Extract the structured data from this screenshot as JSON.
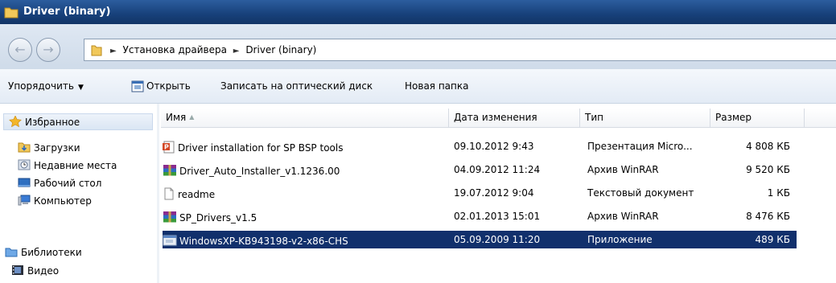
{
  "window": {
    "title": "Driver (binary)"
  },
  "address": {
    "crumbs": [
      "Установка драйвера",
      "Driver (binary)"
    ]
  },
  "toolbar": {
    "organize": "Упорядочить",
    "open": "Открыть",
    "burn": "Записать на оптический диск",
    "new_folder": "Новая папка"
  },
  "nav": {
    "favorites": "Избранное",
    "downloads": "Загрузки",
    "recent": "Недавние места",
    "desktop": "Рабочий стол",
    "computer": "Компьютер",
    "libraries": "Библиотеки",
    "video": "Видео"
  },
  "columns": {
    "name": "Имя",
    "date": "Дата изменения",
    "type": "Тип",
    "size": "Размер"
  },
  "files": [
    {
      "name": "Driver installation for SP BSP tools",
      "date": "09.10.2012 9:43",
      "type": "Презентация Micro...",
      "size": "4 808 КБ",
      "icon": "powerpoint-icon"
    },
    {
      "name": "Driver_Auto_Installer_v1.1236.00",
      "date": "04.09.2012 11:24",
      "type": "Архив WinRAR",
      "size": "9 520 КБ",
      "icon": "winrar-icon"
    },
    {
      "name": "readme",
      "date": "19.07.2012 9:04",
      "type": "Текстовый документ",
      "size": "1 КБ",
      "icon": "text-file-icon"
    },
    {
      "name": "SP_Drivers_v1.5",
      "date": "02.01.2013 15:01",
      "type": "Архив WinRAR",
      "size": "8 476 КБ",
      "icon": "winrar-icon"
    },
    {
      "name": "WindowsXP-KB943198-v2-x86-CHS",
      "date": "05.09.2009 11:20",
      "type": "Приложение",
      "size": "489 КБ",
      "icon": "application-icon"
    }
  ],
  "colors": {
    "selection": "#11306c",
    "title_bar": "#17407a",
    "toolbar": "#e3ebf5"
  }
}
